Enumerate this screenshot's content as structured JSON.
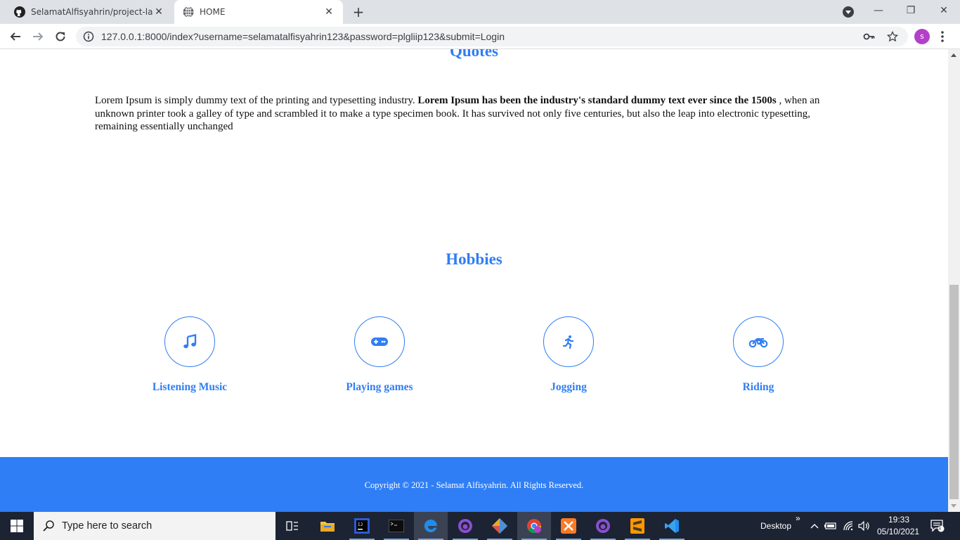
{
  "browser": {
    "tabs": [
      {
        "title": "SelamatAlfisyahrin/project-larave",
        "active": false,
        "icon": "github-icon"
      },
      {
        "title": "HOME",
        "active": true,
        "icon": "globe-icon"
      }
    ],
    "url": "127.0.0.1:8000/index?username=selamatalfisyahrin123&password=plgliip123&submit=Login",
    "profile_initial": "s",
    "new_tab_symbol": "+",
    "close_symbol": "✕",
    "window_controls": {
      "minimize": "—",
      "maximize": "❐",
      "close": "✕"
    }
  },
  "page": {
    "quotes_title": "Quotes",
    "quote": {
      "part1": "Lorem Ipsum is simply dummy text of the printing and typesetting industry. ",
      "bold": "Lorem Ipsum has been the industry's standard dummy text ever since the 1500s",
      "part2": " , when an unknown printer took a galley of type and scrambled it to make a type specimen book. It has survived not only five centuries, but also the leap into electronic typesetting, remaining essentially unchanged"
    },
    "hobbies_title": "Hobbies",
    "hobbies": [
      {
        "label": "Listening Music",
        "icon": "music-icon"
      },
      {
        "label": "Playing games",
        "icon": "gamepad-icon"
      },
      {
        "label": "Jogging",
        "icon": "running-icon"
      },
      {
        "label": "Riding",
        "icon": "motorcycle-icon"
      }
    ],
    "footer": "Copyright © 2021 - Selamat Alfisyahrin. All Rights Reserved.",
    "accent_color": "#2f7ef5"
  },
  "taskbar": {
    "search_placeholder": "Type here to search",
    "apps": [
      "task-view-icon",
      "file-explorer-icon",
      "intellij-icon",
      "terminal-icon",
      "edge-icon",
      "github-desktop-icon",
      "git-icon",
      "chrome-icon",
      "xampp-icon",
      "github-desktop-icon",
      "sublime-icon",
      "vscode-icon"
    ],
    "desktop_label": "Desktop",
    "chevron": "»",
    "time": "19:33",
    "date": "05/10/2021",
    "notification_count": "1"
  }
}
